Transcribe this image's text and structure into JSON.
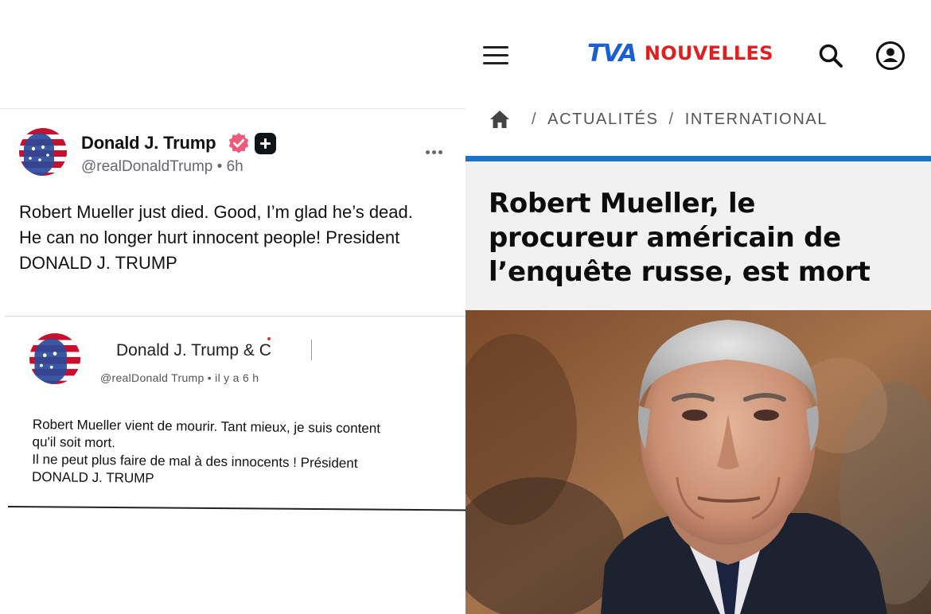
{
  "post": {
    "display_name": "Donald J. Trump",
    "handle": "@realDonaldTrump",
    "time": "6h",
    "body_lines": [
      "Robert Mueller just died. Good, I’m glad he’s dead.",
      "He can no longer hurt innocent people! President",
      "DONALD J. TRUMP"
    ]
  },
  "post_fr": {
    "display_name": "Donald J. Trump & C",
    "handle_line": "@realDonald Trump • il y a 6 h",
    "body_lines": [
      "Robert Mueller vient de mourir. Tant mieux, je suis content",
      "qu'il soit mort.",
      "Il ne peut plus faire de mal à des innocents ! Président",
      "DONALD J. TRUMP"
    ]
  },
  "article": {
    "logo_tva": "TVA",
    "logo_text": "NOUVELLES",
    "breadcrumb": [
      "ACTUALITÉS",
      "INTERNATIONAL"
    ],
    "headline_lines": [
      "Robert Mueller, le",
      "procureur américain de",
      "l’enquête russe, est mort"
    ]
  },
  "colors": {
    "tva_blue": "#1a5fd6",
    "nouvelles_red": "#e02020",
    "accent_bar": "#1b73c9",
    "verified_pink": "#f0597a"
  },
  "icons": [
    "verified-icon",
    "plus-icon",
    "more-icon",
    "menu-icon",
    "search-icon",
    "user-icon",
    "home-icon"
  ]
}
